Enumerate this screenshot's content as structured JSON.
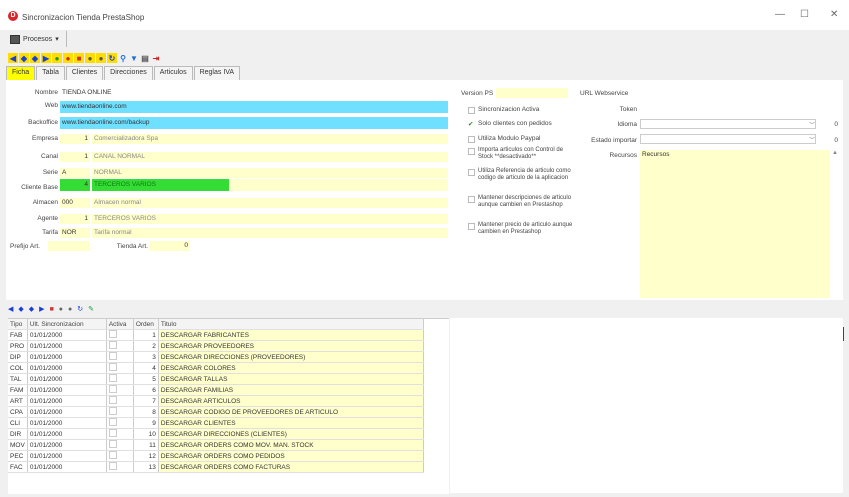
{
  "window": {
    "title": "Sincronizacion Tienda PrestaShop",
    "app_icon": "D",
    "min": "—",
    "max": "☐",
    "close": "✕"
  },
  "menu": {
    "procesos": "Procesos"
  },
  "tabs": [
    "Ficha",
    "Tabla",
    "Clientes",
    "Direcciones",
    "Articulos",
    "Reglas IVA"
  ],
  "form": {
    "nombre_label": "Nombre",
    "nombre": "TIENDA ONLINE",
    "web_label": "Web",
    "web": "www.tiendaonline.com",
    "backoffice_label": "Backoffice",
    "backoffice": "www.tiendaonline.com/backup",
    "empresa_label": "Empresa",
    "empresa_num": "1",
    "empresa": "Comercializadora Spa",
    "canal_label": "Canal",
    "canal_num": "1",
    "canal": "CANAL NORMAL",
    "serie_label": "Serie",
    "serie_code": "A",
    "serie": "NORMAL",
    "cliente_label": "Cliente Base",
    "cliente_num": "4",
    "cliente": "TERCEROS VARIOS",
    "almacen_label": "Almacen",
    "almacen_code": "000",
    "almacen": "Almacen normal",
    "agente_label": "Agente",
    "agente_num": "1",
    "agente": "TERCEROS VARIOS",
    "tarifa_label": "Tarifa",
    "tarifa_code": "NOR",
    "tarifa": "Tarifa normal",
    "prefijo_label": "Prefijo Art.",
    "tienda_label": "Tienda Art.",
    "tienda_value": "0",
    "version_label": "Version PS",
    "checks": [
      "Sincronizacion Activa",
      "Solo clientes con pedidos",
      "Utiliza Modulo Paypal",
      "Importa articulos con Control de Stock **desactivado**",
      "Utiliza Referencia de articulo como codigo de articulo de la aplicacion",
      "Mantener descripciones de articulo aunque cambien en Prestashop",
      "Mantener precio de articulo aunque cambien en Prestashop"
    ],
    "url_label": "URL Webservice",
    "token_label": "Token",
    "idioma_label": "Idioma",
    "idioma_value": "0",
    "estado_label": "Estado importar",
    "estado_value": "0",
    "recursos_label": "Recursos",
    "recursos_value": "Recursos"
  },
  "grid": {
    "headers": [
      "Tipo",
      "Ult. Sincronizacion",
      "Activa",
      "Orden",
      "Titulo"
    ],
    "rows": [
      [
        "FAB",
        "01/01/2000",
        "1",
        "DESCARGAR FABRICANTES"
      ],
      [
        "PRO",
        "01/01/2000",
        "2",
        "DESCARGAR PROVEEDORES"
      ],
      [
        "DIP",
        "01/01/2000",
        "3",
        "DESCARGAR DIRECCIONES (PROVEEDORES)"
      ],
      [
        "COL",
        "01/01/2000",
        "4",
        "DESCARGAR COLORES"
      ],
      [
        "TAL",
        "01/01/2000",
        "5",
        "DESCARGAR TALLAS"
      ],
      [
        "FAM",
        "01/01/2000",
        "6",
        "DESCARGAR FAMILIAS"
      ],
      [
        "ART",
        "01/01/2000",
        "7",
        "DESCARGAR ARTICULOS"
      ],
      [
        "CPA",
        "01/01/2000",
        "8",
        "DESCARGAR CODIGO DE PROVEEDORES DE ARTICULO"
      ],
      [
        "CLI",
        "01/01/2000",
        "9",
        "DESCARGAR CLIENTES"
      ],
      [
        "DIR",
        "01/01/2000",
        "10",
        "DESCARGAR DIRECCIONES (CLIENTES)"
      ],
      [
        "MOV",
        "01/01/2000",
        "11",
        "DESCARGAR ORDERS COMO MOV. MAN. STOCK"
      ],
      [
        "PEC",
        "01/01/2000",
        "12",
        "DESCARGAR ORDERS COMO PEDIDOS"
      ],
      [
        "FAC",
        "01/01/2000",
        "13",
        "DESCARGAR ORDERS COMO FACTURAS"
      ]
    ]
  }
}
